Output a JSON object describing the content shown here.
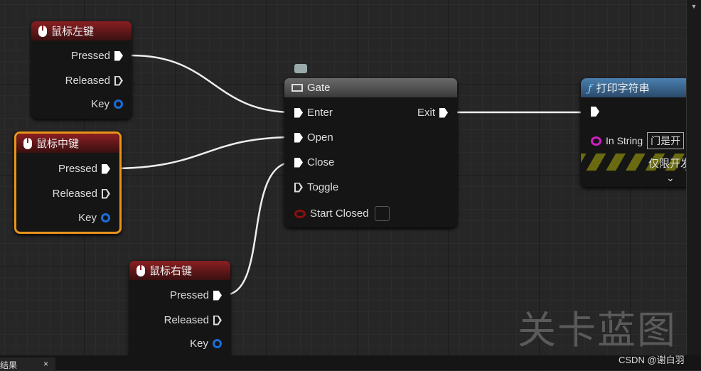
{
  "nodes": {
    "left": {
      "title": "鼠标左键",
      "pressed": "Pressed",
      "released": "Released",
      "key": "Key"
    },
    "middle": {
      "title": "鼠标中键",
      "pressed": "Pressed",
      "released": "Released",
      "key": "Key"
    },
    "right": {
      "title": "鼠标右键",
      "pressed": "Pressed",
      "released": "Released",
      "key": "Key"
    },
    "gate": {
      "title": "Gate",
      "enter": "Enter",
      "open": "Open",
      "close": "Close",
      "toggle": "Toggle",
      "start_closed": "Start Closed",
      "exit": "Exit"
    },
    "print": {
      "title": "打印字符串",
      "func_icon": "ƒ",
      "in_string_label": "In String",
      "in_string_value": "门是开",
      "dev_only": "仅限开发"
    }
  },
  "watermark": "关卡蓝图",
  "credit": "CSDN @谢白羽",
  "bottom_tab": {
    "label": "结果",
    "close": "×"
  },
  "colors": {
    "selected": "#e8941a",
    "key_pin": "#1a6ed8",
    "string_pin": "#d020c0",
    "bool_pin": "#8a0f0f",
    "print_header": "#3a6a96"
  }
}
